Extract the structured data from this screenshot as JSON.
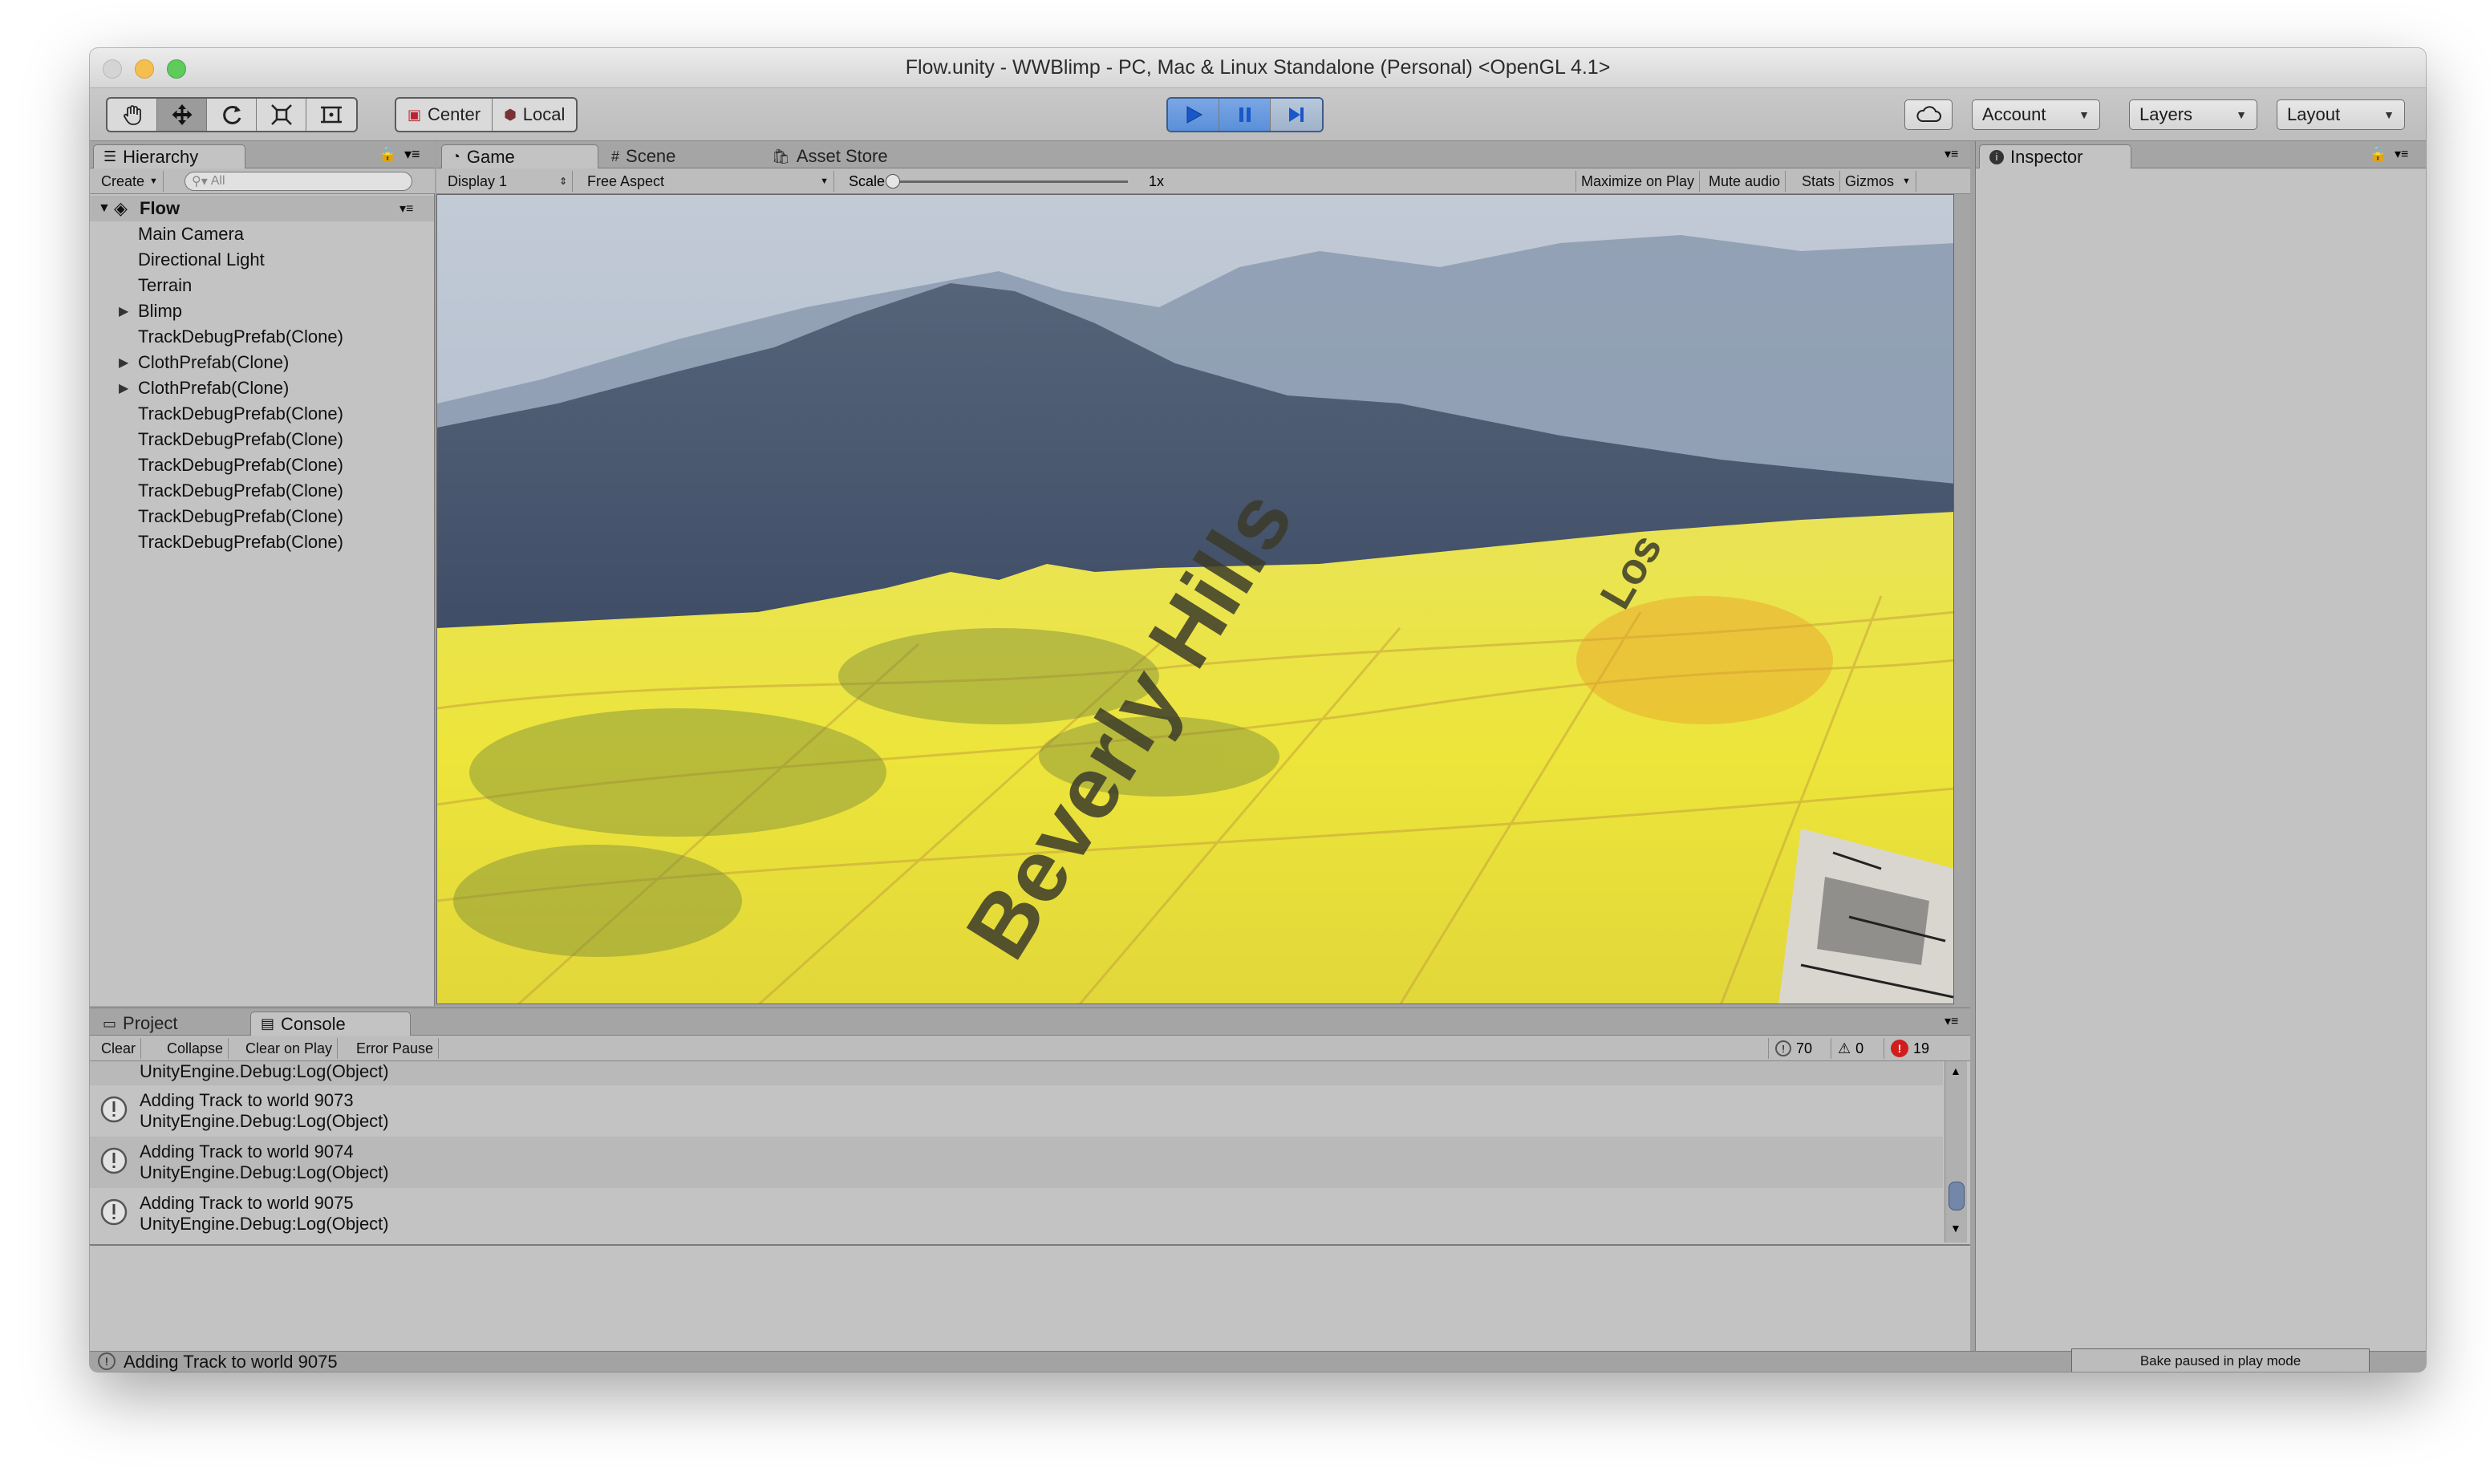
{
  "window": {
    "title": "Flow.unity - WWBlimp - PC, Mac & Linux Standalone (Personal) <OpenGL 4.1>"
  },
  "toolbar": {
    "tools": [
      "hand-icon",
      "move-icon",
      "rotate-icon",
      "scale-icon",
      "rect-icon"
    ],
    "pivot_label": "Center",
    "space_label": "Local",
    "account_label": "Account",
    "layers_label": "Layers",
    "layout_label": "Layout"
  },
  "hierarchy": {
    "tab_label": "Hierarchy",
    "create_label": "Create",
    "search_placeholder": "All",
    "scene_name": "Flow",
    "items": [
      {
        "label": "Main Camera",
        "expandable": false
      },
      {
        "label": "Directional Light",
        "expandable": false
      },
      {
        "label": "Terrain",
        "expandable": false
      },
      {
        "label": "Blimp",
        "expandable": true
      },
      {
        "label": "TrackDebugPrefab(Clone)",
        "expandable": false
      },
      {
        "label": "ClothPrefab(Clone)",
        "expandable": true
      },
      {
        "label": "ClothPrefab(Clone)",
        "expandable": true
      },
      {
        "label": "TrackDebugPrefab(Clone)",
        "expandable": false
      },
      {
        "label": "TrackDebugPrefab(Clone)",
        "expandable": false
      },
      {
        "label": "TrackDebugPrefab(Clone)",
        "expandable": false
      },
      {
        "label": "TrackDebugPrefab(Clone)",
        "expandable": false
      },
      {
        "label": "TrackDebugPrefab(Clone)",
        "expandable": false
      },
      {
        "label": "TrackDebugPrefab(Clone)",
        "expandable": false
      }
    ]
  },
  "game": {
    "tabs": {
      "game": "Game",
      "scene": "Scene",
      "asset_store": "Asset Store"
    },
    "display_label": "Display 1",
    "aspect_label": "Free Aspect",
    "scale_label": "Scale",
    "scale_value": "1x",
    "maximize_label": "Maximize on Play",
    "mute_label": "Mute audio",
    "stats_label": "Stats",
    "gizmos_label": "Gizmos",
    "map_text_hills": "Beverly Hills",
    "map_text_los": "Los"
  },
  "inspector": {
    "tab_label": "Inspector"
  },
  "console": {
    "tabs": {
      "project": "Project",
      "console": "Console"
    },
    "clear_label": "Clear",
    "collapse_label": "Collapse",
    "clear_on_play_label": "Clear on Play",
    "error_pause_label": "Error Pause",
    "log_count": "70",
    "warning_count": "0",
    "error_count": "19",
    "partial_line": "UnityEngine.Debug:Log(Object)",
    "entries": [
      {
        "line1": "Adding Track to world 9073",
        "line2": "UnityEngine.Debug:Log(Object)"
      },
      {
        "line1": "Adding Track to world 9074",
        "line2": "UnityEngine.Debug:Log(Object)"
      },
      {
        "line1": "Adding Track to world 9075",
        "line2": "UnityEngine.Debug:Log(Object)"
      }
    ]
  },
  "status": {
    "message": "Adding Track to world 9075",
    "bake_label": "Bake paused in play mode"
  },
  "colors": {
    "play_active": "#5a8fd8",
    "map_yellow": "#e8e23a",
    "error_red": "#d21d1d"
  }
}
